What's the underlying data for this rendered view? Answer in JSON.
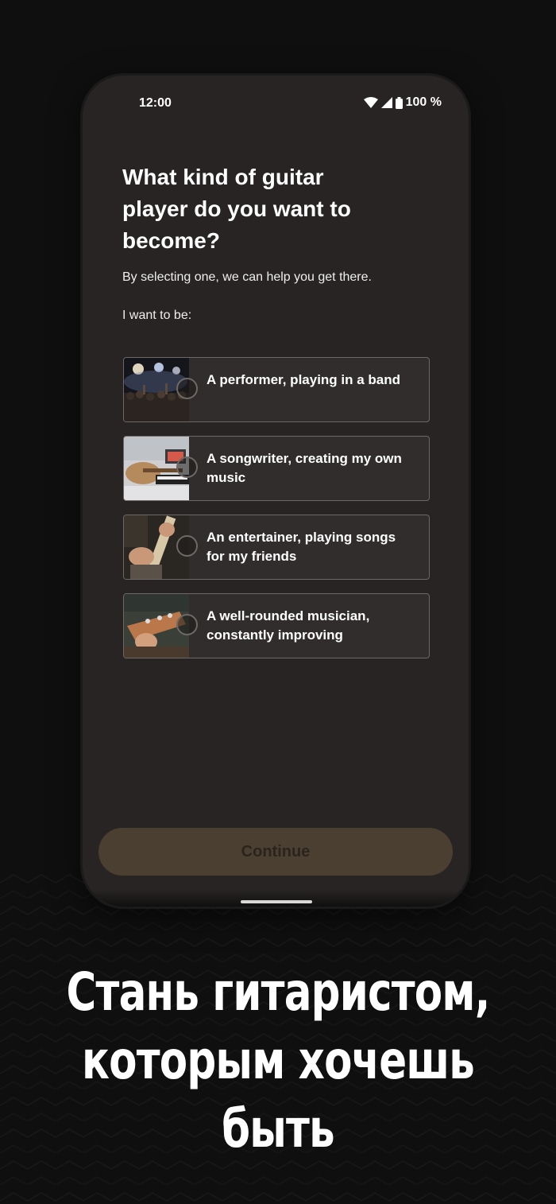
{
  "status_bar": {
    "time": "12:00",
    "battery": "100 %"
  },
  "screen": {
    "title": "What kind of guitar player do you want to become?",
    "subtitle": "By selecting one, we can help you get there.",
    "prompt": "I want to be:",
    "options": [
      {
        "label": "A performer, playing in a band",
        "image": "concert-crowd-photo",
        "selected": false
      },
      {
        "label": "A songwriter, creating my own music",
        "image": "guitar-laptop-photo",
        "selected": false
      },
      {
        "label": "An entertainer, playing songs for my friends",
        "image": "hands-guitar-neck-photo",
        "selected": false
      },
      {
        "label": "A well-rounded musician, constantly improving",
        "image": "headstock-tuning-photo",
        "selected": false
      }
    ],
    "continue_label": "Continue",
    "continue_enabled": false
  },
  "promo": {
    "tagline": "Стань гитаристом, которым хочешь быть"
  },
  "colors": {
    "background": "#0f0f0f",
    "screen": "#272423",
    "button_disabled": "#4b3f31",
    "text": "#ffffff"
  }
}
